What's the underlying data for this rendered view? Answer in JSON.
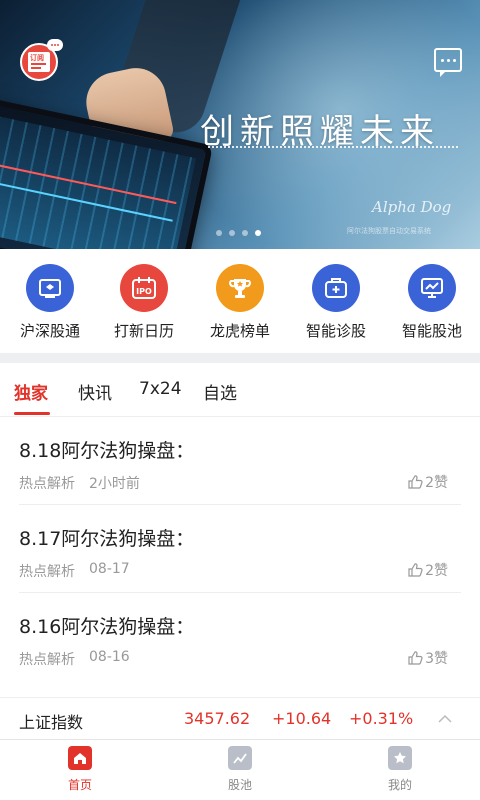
{
  "banner": {
    "slogan": "创新照耀未来",
    "brand": "Alpha Dog",
    "brand_sub": "阿尔法狗股票自动交易系统",
    "dots": 4,
    "active_dot": 4
  },
  "subscribe": {
    "badge_text": "订阅",
    "icon": "subscribe-icon"
  },
  "messages": {
    "icon": "message-icon"
  },
  "quick_menu": [
    {
      "label": "沪深股通",
      "icon": "hk-connect-icon",
      "color": "#3a63d8"
    },
    {
      "label": "打新日历",
      "icon": "ipo-calendar-icon",
      "color": "#e8473e",
      "badge": "IPO"
    },
    {
      "label": "龙虎榜单",
      "icon": "trophy-icon",
      "color": "#f19a1b"
    },
    {
      "label": "智能诊股",
      "icon": "medical-kit-icon",
      "color": "#3a63d8"
    },
    {
      "label": "智能股池",
      "icon": "monitor-chart-icon",
      "color": "#3a63d8"
    }
  ],
  "tabs": [
    "独家",
    "快讯",
    "7x24",
    "自选"
  ],
  "active_tab": 0,
  "news": [
    {
      "title": "8.18阿尔法狗操盘：",
      "category": "热点解析",
      "time": "2小时前",
      "likes": "2赞"
    },
    {
      "title": "8.17阿尔法狗操盘：",
      "category": "热点解析",
      "time": "08-17",
      "likes": "2赞"
    },
    {
      "title": "8.16阿尔法狗操盘：",
      "category": "热点解析",
      "time": "08-16",
      "likes": "3赞"
    }
  ],
  "ticker": {
    "name": "上证指数",
    "price": "3457.62",
    "change": "+10.64",
    "percent": "+0.31%",
    "color": "#e2332a"
  },
  "bottom_nav": [
    {
      "label": "首页",
      "icon": "home-icon",
      "active": true
    },
    {
      "label": "股池",
      "icon": "chart-pool-icon",
      "active": false
    },
    {
      "label": "我的",
      "icon": "profile-star-icon",
      "active": false
    }
  ],
  "colors": {
    "accent": "#e2332a",
    "blue": "#3a63d8",
    "orange": "#f19a1b",
    "gray_text": "#999999"
  }
}
